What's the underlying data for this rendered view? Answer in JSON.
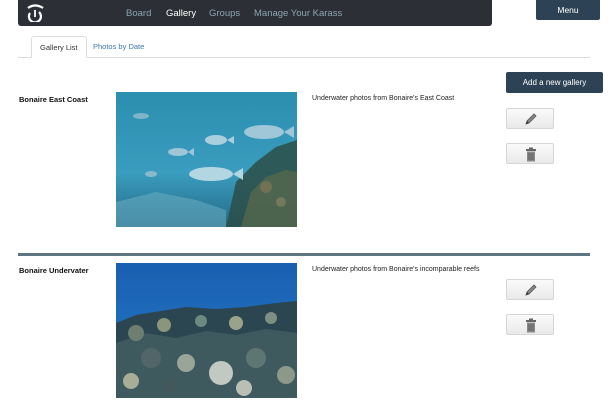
{
  "nav": {
    "logo_icon": "karass-logo-icon",
    "links": [
      "Board",
      "Gallery",
      "Groups",
      "Manage Your Karass"
    ],
    "active": "Gallery",
    "menu_label": "Menu"
  },
  "tabs": {
    "gallery_list": "Gallery List",
    "photos_by_date": "Photos by Date"
  },
  "add_gallery_label": "Add a new gallery",
  "galleries": [
    {
      "title": "Bonaire East Coast",
      "description": "Underwater photos from Bonaire's East Coast",
      "edit_icon": "pencil-icon",
      "delete_icon": "trash-icon"
    },
    {
      "title": "Bonaire Undervater",
      "description": "Underwater photos from Bonaire's incomparable reefs",
      "edit_icon": "pencil-icon",
      "delete_icon": "trash-icon"
    }
  ],
  "colors": {
    "navbar": "#2c3036",
    "button_dark": "#2d4255",
    "nav_link": "#8ea3b3",
    "tab_link": "#3a78b0",
    "divider": "#5e7682"
  }
}
